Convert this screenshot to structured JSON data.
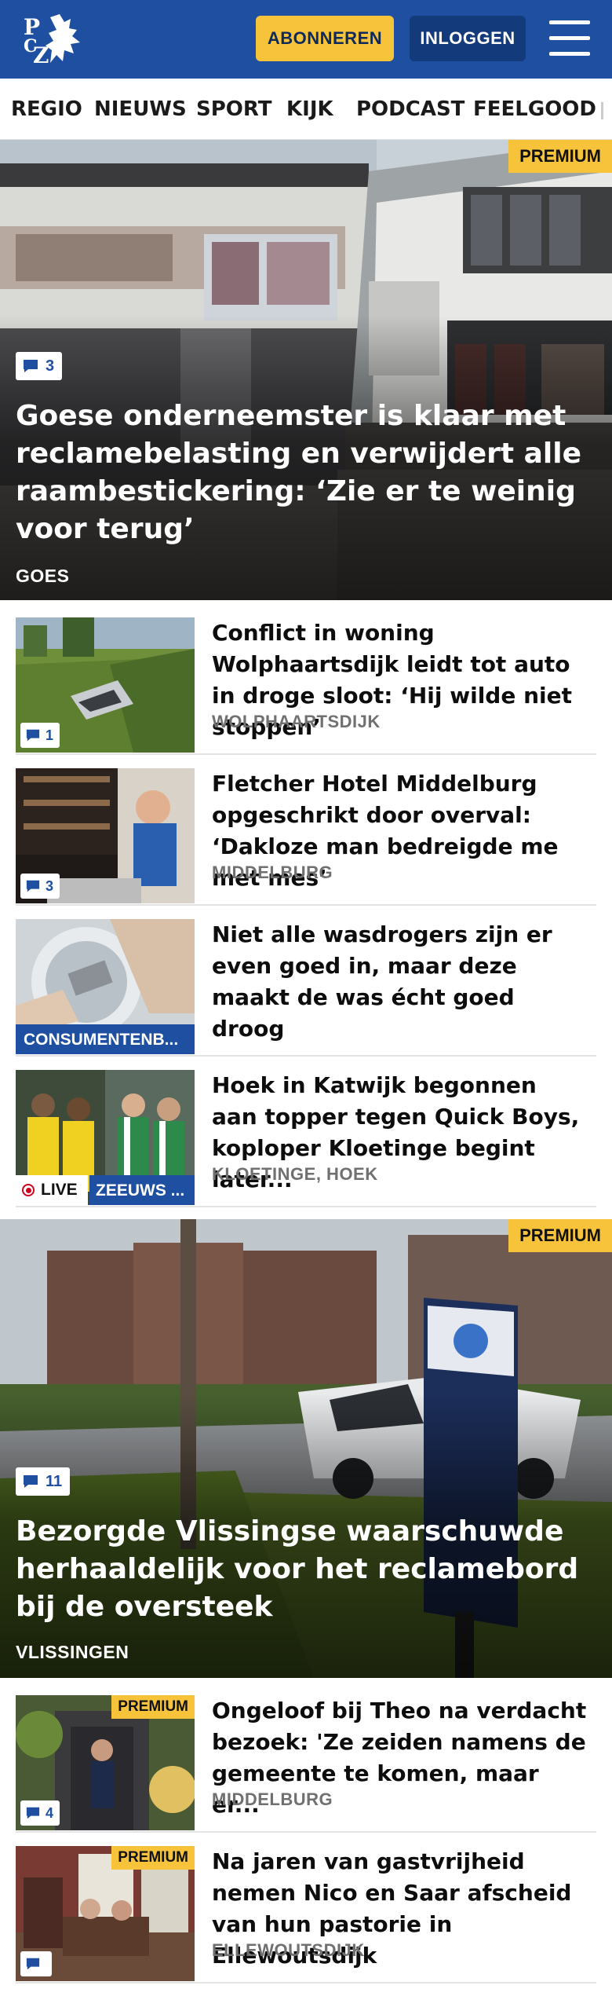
{
  "header": {
    "logo_text": "PZC",
    "subscribe_label": "ABONNEREN",
    "login_label": "INLOGGEN"
  },
  "nav": {
    "items": [
      "REGIO",
      "NIEUWS",
      "SPORT",
      "KIJK",
      "PODCAST",
      "FEELGOOD"
    ]
  },
  "hero1": {
    "premium": "PREMIUM",
    "comments": "3",
    "title": "Goese onderneemster is klaar met reclamebelasting en verwijdert alle raambestickering: ‘Zie er te weinig voor terug’",
    "location": "GOES"
  },
  "articles": [
    {
      "title": "Conflict in woning Wolphaarts­dijk leidt tot auto in droge sloot: ‘Hij wilde niet stoppen’",
      "location": "WOLPHAARTSDIJK",
      "comments": "1"
    },
    {
      "title": "Fletcher Hotel Middelburg opge­schrikt door overval: ‘Dakloze man bedreigde me met mes’",
      "location": "MIDDELBURG",
      "comments": "3"
    },
    {
      "title": "Niet alle wasdrogers zijn er even goed in, maar deze maakt de was écht goed droog",
      "category": "CONSUMENTENB..."
    },
    {
      "title": "Hoek in Katwijk begonnen aan topper tegen Quick Boys, koploper Kloetinge begint later...",
      "location": "KLOETINGE, HOEK",
      "live": "LIVE",
      "category": "ZEEUWS ..."
    }
  ],
  "hero2": {
    "premium": "PREMIUM",
    "comments": "11",
    "title": "Bezorgde Vlissingse waarschuwde herhaaldelijk voor het reclamebord bij de oversteek",
    "location": "VLISSINGEN"
  },
  "articles2": [
    {
      "title": "Ongeloof bij Theo na verdacht bezoek: 'Ze zeiden namens de gemeente te komen, maar er...",
      "location": "MIDDELBURG",
      "premium": "PREMIUM",
      "comments": "4"
    },
    {
      "title": "Na jaren van gastvrijheid nemen Nico en Saar afscheid van hun pastorie in Ellewoutsdijk",
      "location": "ELLEWOUTSDIJK",
      "premium": "PREMIUM"
    }
  ],
  "colors": {
    "brand_blue": "#1e4fa1",
    "login_blue": "#133a7a",
    "premium_yellow": "#f7c33b",
    "live_red": "#d0021b"
  }
}
